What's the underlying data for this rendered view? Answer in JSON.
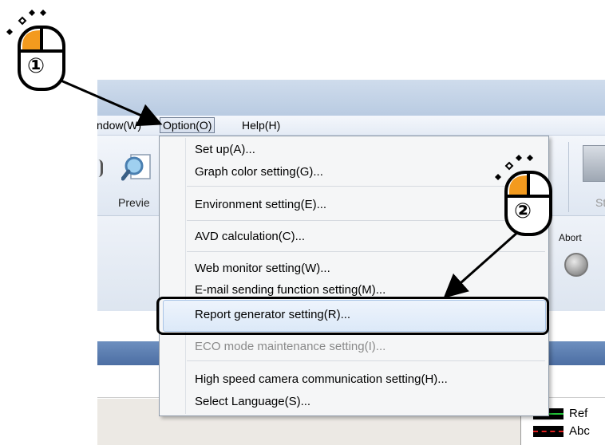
{
  "menubar": {
    "window_label": "ndow(W)",
    "option_label": "Option(O)",
    "help_label": "Help(H)"
  },
  "toolbar": {
    "preview_label": "Previe",
    "right_label": "St"
  },
  "panel": {
    "abort_label": "Abort"
  },
  "option_menu": {
    "items": [
      {
        "label": "Set up(A)...",
        "enabled": true
      },
      {
        "label": "Graph color setting(G)...",
        "enabled": true
      },
      {
        "label": "Environment setting(E)...",
        "enabled": true
      },
      {
        "label": "AVD calculation(C)...",
        "enabled": true
      },
      {
        "label": "Web monitor setting(W)...",
        "enabled": true
      },
      {
        "label": "E-mail sending function setting(M)...",
        "enabled": true
      },
      {
        "label": "Report generator setting(R)...",
        "enabled": true,
        "highlighted": true
      },
      {
        "label": "ECO mode maintenance setting(I)...",
        "enabled": false
      },
      {
        "label": "High speed camera communication setting(H)...",
        "enabled": true
      },
      {
        "label": "Select Language(S)...",
        "enabled": true
      }
    ]
  },
  "legend": {
    "items": [
      {
        "label": "Ref",
        "color": "#22c037"
      },
      {
        "label": "Abc",
        "color": "#e02020"
      }
    ]
  },
  "annotations": {
    "step1": "①",
    "step2": "②"
  },
  "colors": {
    "mouse_button": "#f39a1e",
    "titlebar": "#c4d3e7",
    "highlight": "#dce9f8"
  }
}
